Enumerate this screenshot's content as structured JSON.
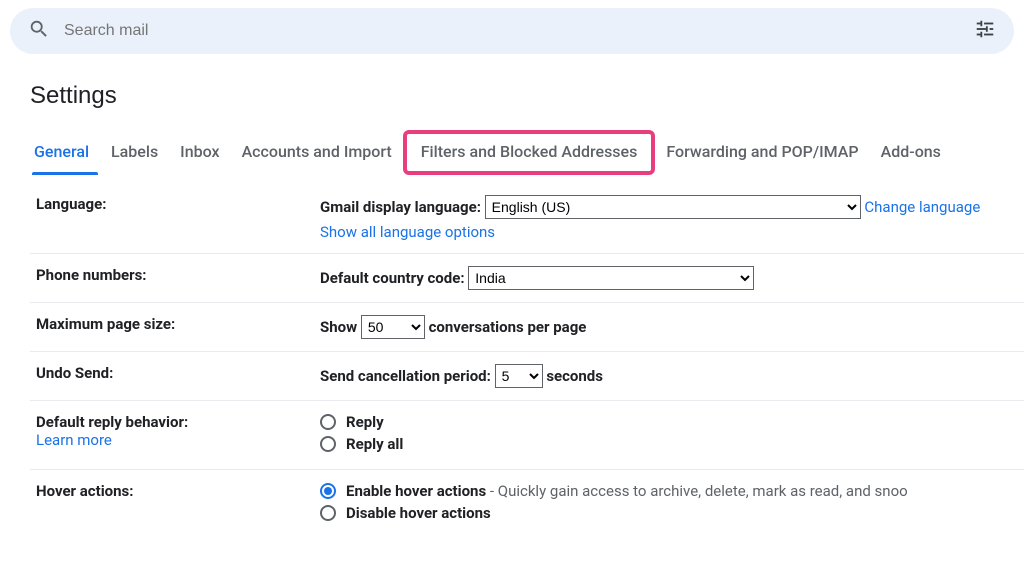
{
  "search": {
    "placeholder": "Search mail"
  },
  "page_title": "Settings",
  "tabs": [
    "General",
    "Labels",
    "Inbox",
    "Accounts and Import",
    "Filters and Blocked Addresses",
    "Forwarding and POP/IMAP",
    "Add-ons"
  ],
  "language": {
    "label": "Language:",
    "display_label": "Gmail display language:",
    "value": "English (US)",
    "change_link": "Change language",
    "show_all": "Show all language options"
  },
  "phone": {
    "label": "Phone numbers:",
    "country_label": "Default country code:",
    "value": "India"
  },
  "pagesize": {
    "label": "Maximum page size:",
    "prefix": "Show",
    "value": "50",
    "suffix": "conversations per page"
  },
  "undo": {
    "label": "Undo Send:",
    "prefix": "Send cancellation period:",
    "value": "5",
    "suffix": "seconds"
  },
  "reply": {
    "label": "Default reply behavior:",
    "learn_more": "Learn more",
    "opt_reply": "Reply",
    "opt_replyall": "Reply all"
  },
  "hover": {
    "label": "Hover actions:",
    "enable": "Enable hover actions",
    "enable_desc": " - Quickly gain access to archive, delete, mark as read, and snoo",
    "disable": "Disable hover actions"
  }
}
